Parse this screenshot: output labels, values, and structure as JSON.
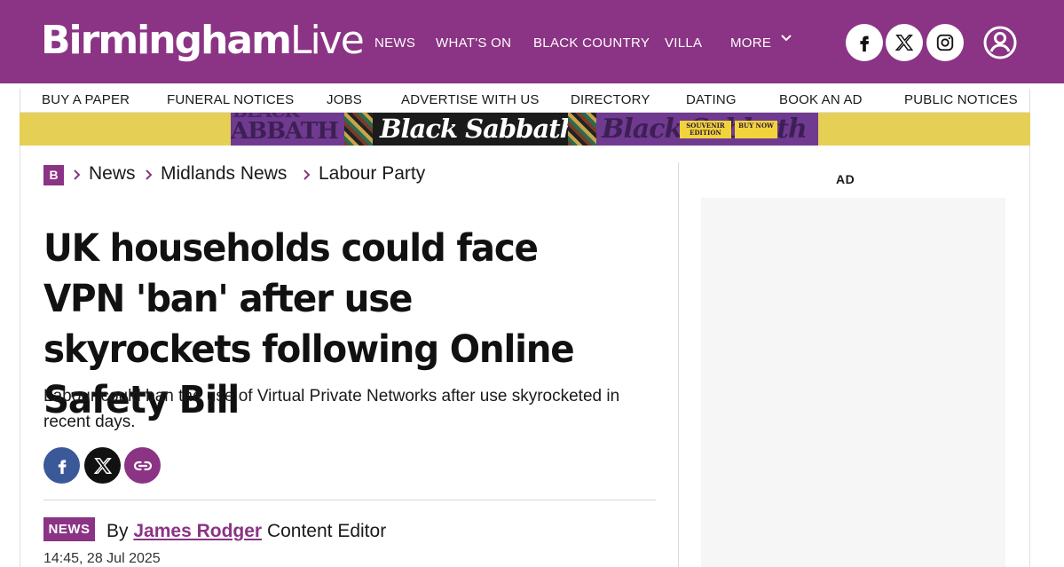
{
  "header": {
    "logo_bold": "Birmingham",
    "logo_light": "Live",
    "nav": [
      {
        "label": "NEWS"
      },
      {
        "label": "WHAT'S ON"
      },
      {
        "label": "BLACK COUNTRY"
      },
      {
        "label": "VILLA"
      },
      {
        "label": "MORE"
      }
    ],
    "social_icons": [
      "facebook-icon",
      "x-icon",
      "instagram-icon"
    ],
    "account_icon": "user-icon",
    "brand_color": "#8b3384"
  },
  "subnav": [
    {
      "label": "BUY A PAPER"
    },
    {
      "label": "FUNERAL NOTICES"
    },
    {
      "label": "JOBS"
    },
    {
      "label": "ADVERTISE WITH US"
    },
    {
      "label": "DIRECTORY"
    },
    {
      "label": "DATING"
    },
    {
      "label": "BOOK AN AD"
    },
    {
      "label": "PUBLIC NOTICES"
    }
  ],
  "banner": {
    "left_text": "ABBATH",
    "left_text_top": "BLACK",
    "title": "Black Sabbath",
    "right_text": "Black Sabbath",
    "badge1": "SOUVENIR EDITION",
    "badge2": "BUY NOW"
  },
  "breadcrumb": {
    "home": "B",
    "items": [
      "News",
      "Midlands News",
      "Labour Party"
    ]
  },
  "article": {
    "headline": "UK households could face VPN 'ban' after use skyrockets following Online Safety Bill",
    "standfirst": "Labour could ban the use of Virtual Private Networks after use skyrocketed in recent days.",
    "share": [
      "facebook-icon",
      "x-icon",
      "link-icon"
    ],
    "tag": "NEWS",
    "by": "By",
    "author": "James Rodger",
    "role": "Content Editor",
    "timestamp": "14:45, 28 Jul 2025"
  },
  "sidebar": {
    "ad_label": "AD"
  }
}
